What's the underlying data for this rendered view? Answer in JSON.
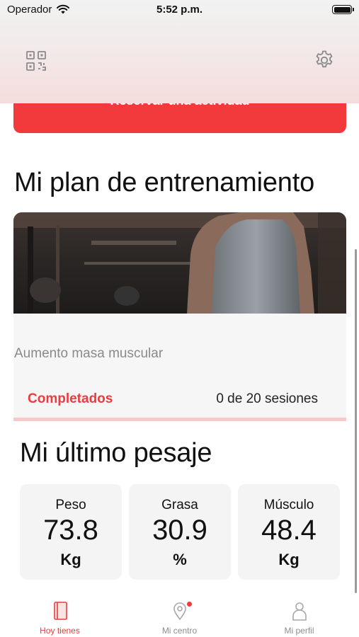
{
  "status_bar": {
    "carrier": "Operador",
    "time": "5:52 p.m."
  },
  "header": {
    "qr_icon": "qr-code-icon",
    "settings_icon": "gear-icon"
  },
  "reserve_button": {
    "label": "Reservar una actividad"
  },
  "plan": {
    "title": "Mi plan de entrenamiento",
    "name": "Aumento masa muscular",
    "completed_label": "Completados",
    "sessions_text": "0 de 20 sesiones",
    "completed": 0,
    "total": 20
  },
  "weigh_in": {
    "title": "Mi último pesaje",
    "stats": [
      {
        "label": "Peso",
        "value": "73.8",
        "unit": "Kg"
      },
      {
        "label": "Grasa",
        "value": "30.9",
        "unit": "%"
      },
      {
        "label": "Músculo",
        "value": "48.4",
        "unit": "Kg"
      }
    ]
  },
  "tabs": [
    {
      "label": "Hoy tienes",
      "icon": "notebook-icon",
      "active": true
    },
    {
      "label": "Mi centro",
      "icon": "location-pin-icon",
      "active": false,
      "badge": true
    },
    {
      "label": "Mi perfil",
      "icon": "person-icon",
      "active": false
    }
  ],
  "colors": {
    "accent": "#ee3b3d",
    "progress_track": "#f7c9c9",
    "card_bg": "#f4f4f4"
  }
}
